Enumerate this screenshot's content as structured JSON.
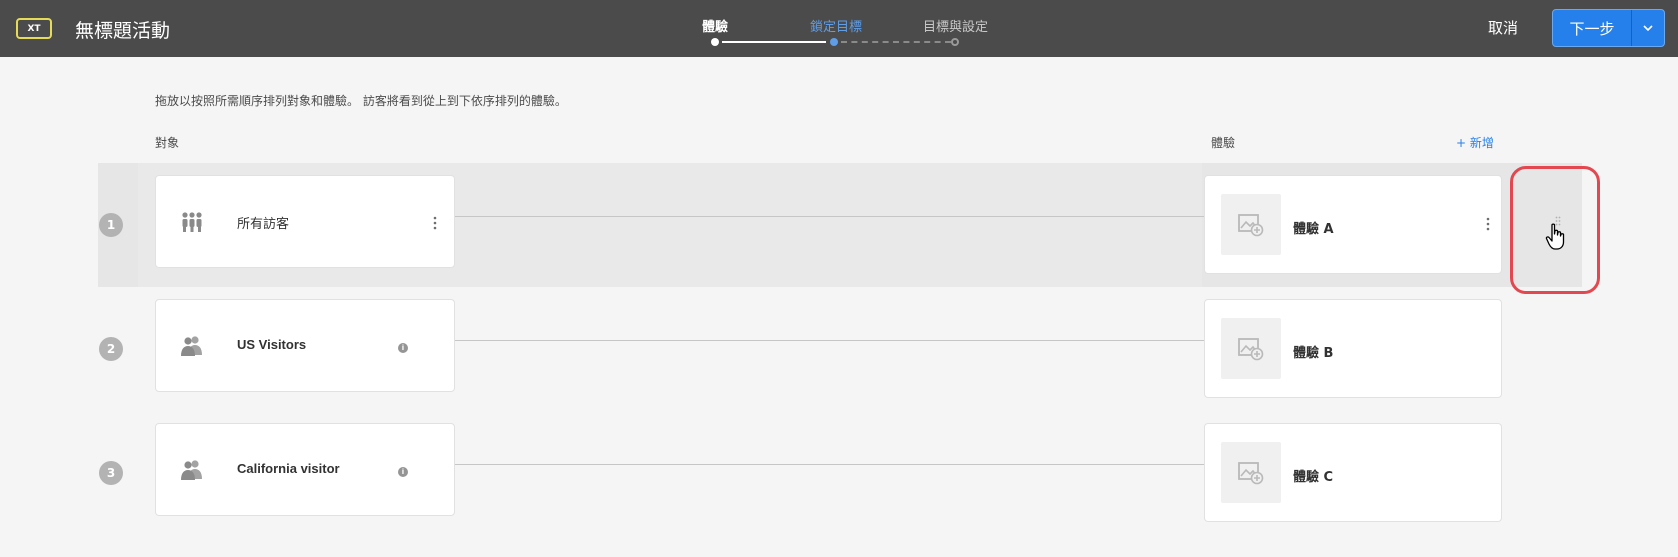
{
  "header": {
    "badge": "XT",
    "title": "無標題活動",
    "steps": [
      {
        "label": "體驗",
        "state": "done"
      },
      {
        "label": "鎖定目標",
        "state": "active"
      },
      {
        "label": "目標與設定",
        "state": "pending"
      }
    ],
    "cancel_label": "取消",
    "next_label": "下一步"
  },
  "main": {
    "instructions": "拖放以按照所需順序排列對象和體驗。 訪客將看到從上到下依序排列的體驗。",
    "audience_column_label": "對象",
    "experience_column_label": "體驗",
    "add_label": "+ 新增",
    "rows": [
      {
        "number": "1",
        "audience": "所有訪客",
        "audience_icon": "group-icon",
        "experience": "體驗 A"
      },
      {
        "number": "2",
        "audience": "US Visitors",
        "audience_icon": "users-icon",
        "experience": "體驗 B"
      },
      {
        "number": "3",
        "audience": "California visitor",
        "audience_icon": "users-icon",
        "experience": "體驗 C"
      }
    ]
  },
  "colors": {
    "header_bg": "#4b4b4b",
    "accent": "#2680eb",
    "badge_border": "#e6db57",
    "highlight": "#e34850"
  }
}
